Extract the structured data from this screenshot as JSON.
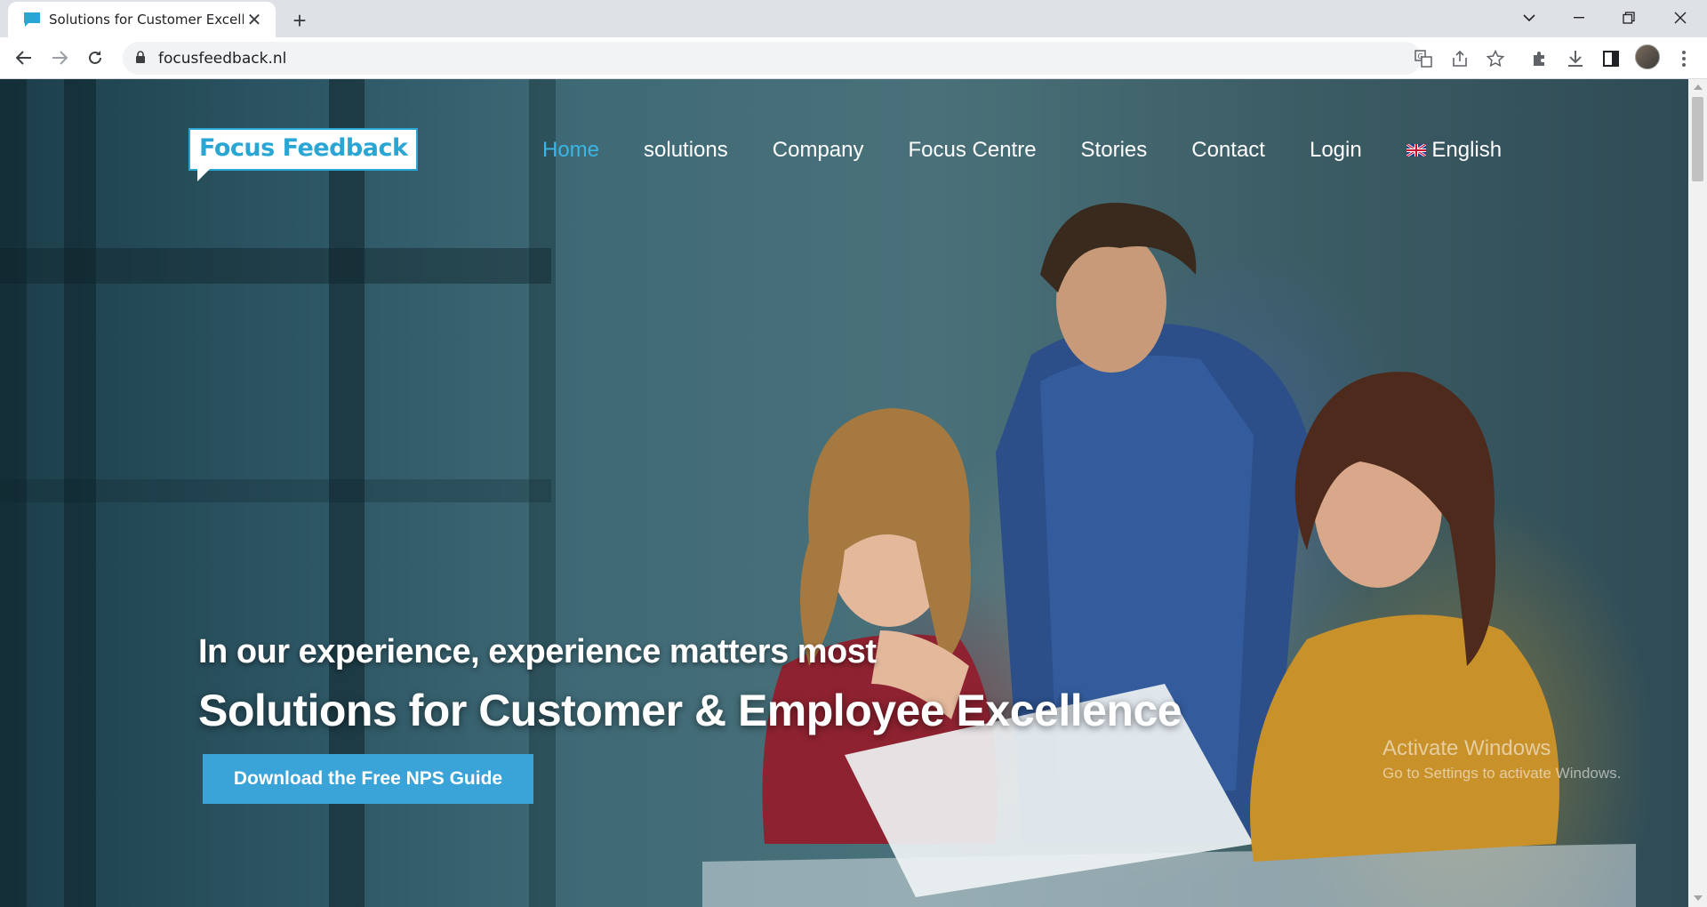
{
  "browser": {
    "tab_title": "Solutions for Customer Excellence",
    "url": "focusfeedback.nl"
  },
  "site": {
    "logo_text": "Focus Feedback",
    "nav": [
      {
        "label": "Home",
        "active": true
      },
      {
        "label": "solutions",
        "active": false
      },
      {
        "label": "Company",
        "active": false
      },
      {
        "label": "Focus Centre",
        "active": false
      },
      {
        "label": "Stories",
        "active": false
      },
      {
        "label": "Contact",
        "active": false
      },
      {
        "label": "Login",
        "active": false
      }
    ],
    "language": "English",
    "accent_color": "#38b6e6"
  },
  "hero": {
    "subtitle": "In our experience, experience matters most",
    "title": "Solutions for Customer & Employee Excellence",
    "cta_label": "Download the Free NPS Guide"
  },
  "watermark": {
    "line1": "Activate Windows",
    "line2": "Go to Settings to activate Windows."
  }
}
